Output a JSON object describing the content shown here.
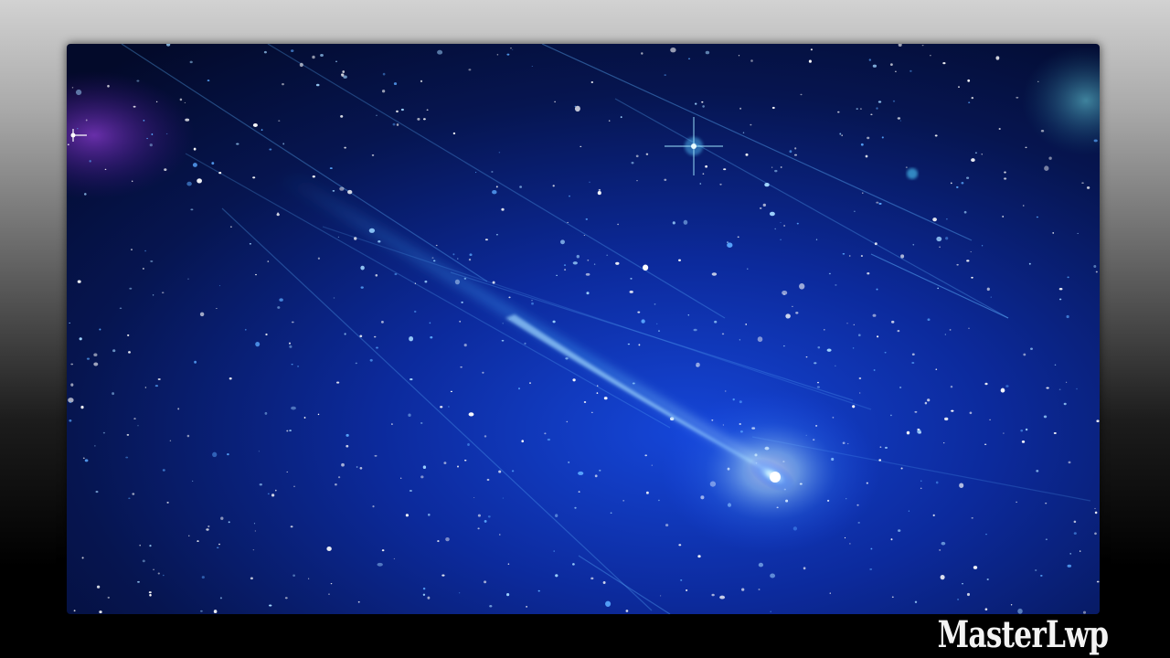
{
  "scene": {
    "subject": "comet",
    "palette": {
      "deep_space": "#040c32",
      "mid_space": "#0a1f7a",
      "glow": "#2a6cff",
      "comet_core": "#ffffff",
      "nebula": "#7a2fb0",
      "star": "#ffffff"
    }
  },
  "watermark": {
    "text": "MasterLwp"
  }
}
